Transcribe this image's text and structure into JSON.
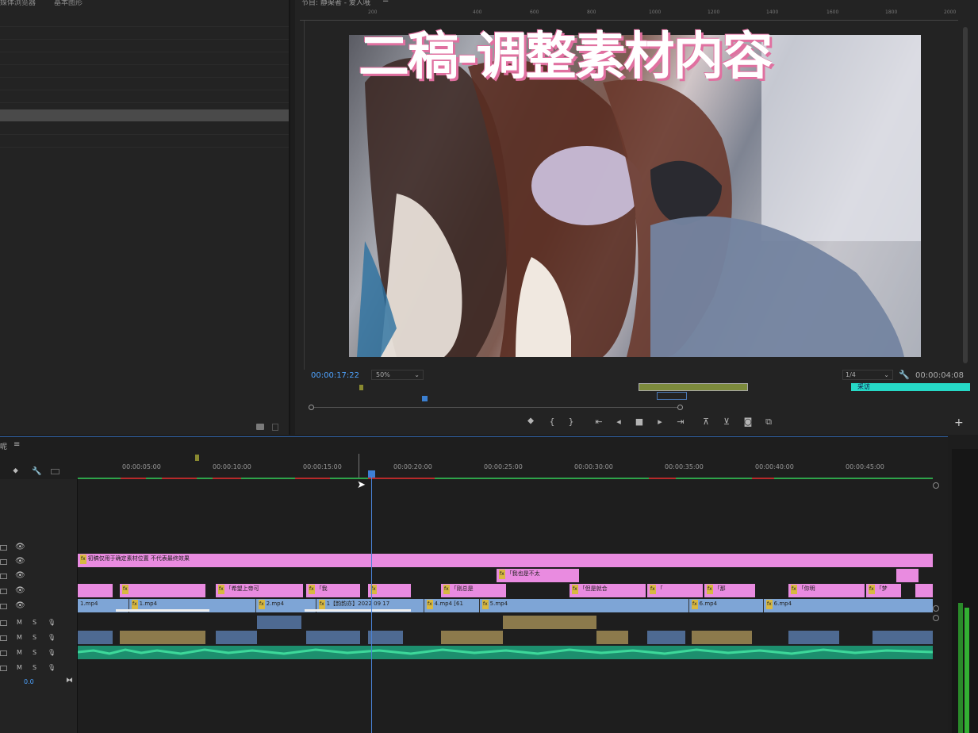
{
  "project": {
    "tab_1": "媒体浏览器",
    "tab_2": "基本图形"
  },
  "program": {
    "title": "节目: 静渠者 - 爱人哦",
    "menu_icon": "≡",
    "overlay_title": "二稿-调整素材内容",
    "timecode_current": "00:00:17:22",
    "zoom": "50%",
    "resolution": "1/4",
    "timecode_duration": "00:00:04:08",
    "cyan_clip_label": "采访",
    "ruler_labels": [
      "200",
      "400",
      "600",
      "800",
      "1000",
      "1200",
      "1400",
      "1600",
      "1800",
      "2000"
    ],
    "transport_buttons": [
      "marker-icon",
      "in-point-icon",
      "out-point-icon",
      "go-to-in-icon",
      "step-back-icon",
      "stop-icon",
      "step-forward-icon",
      "go-to-out-icon",
      "lift-icon",
      "extract-icon",
      "export-frame-icon",
      "compare-icon"
    ]
  },
  "timeline": {
    "tab_label": "呢",
    "menu_icon": "≡",
    "time_labels": [
      "00:00:05:00",
      "00:00:10:00",
      "00:00:15:00",
      "00:00:20:00",
      "00:00:25:00",
      "00:00:30:00",
      "00:00:35:00",
      "00:00:40:00",
      "00:00:45:00"
    ],
    "volume_value": "0.0",
    "v5_text": "初稿仅用于确定素材位置 不代表最终效果",
    "v4_clips": [
      "「我也是不太"
    ],
    "v3_clips": [
      "「希望上帝可",
      "「我",
      "「刚总是",
      "「但是就合",
      "「",
      "「那",
      "「你明",
      "「梦"
    ],
    "v1_clips": [
      "1.mp4",
      "1.mp4",
      "2.mp4",
      "1【韵韵亦】2022 09 17",
      "4.mp4 [61.",
      "5.mp4",
      "6.mp4",
      "6.mp4"
    ],
    "audio_labels": [
      "M",
      "S"
    ]
  },
  "colors": {
    "accent": "#4ea3ff",
    "clip_pink": "#e98be0",
    "clip_blue": "#7ea5d6",
    "clip_tan": "#c8b283",
    "audio_green": "#1d8f6e",
    "ruler_green": "#2ea34a",
    "ruler_red": "#b72a2a"
  }
}
